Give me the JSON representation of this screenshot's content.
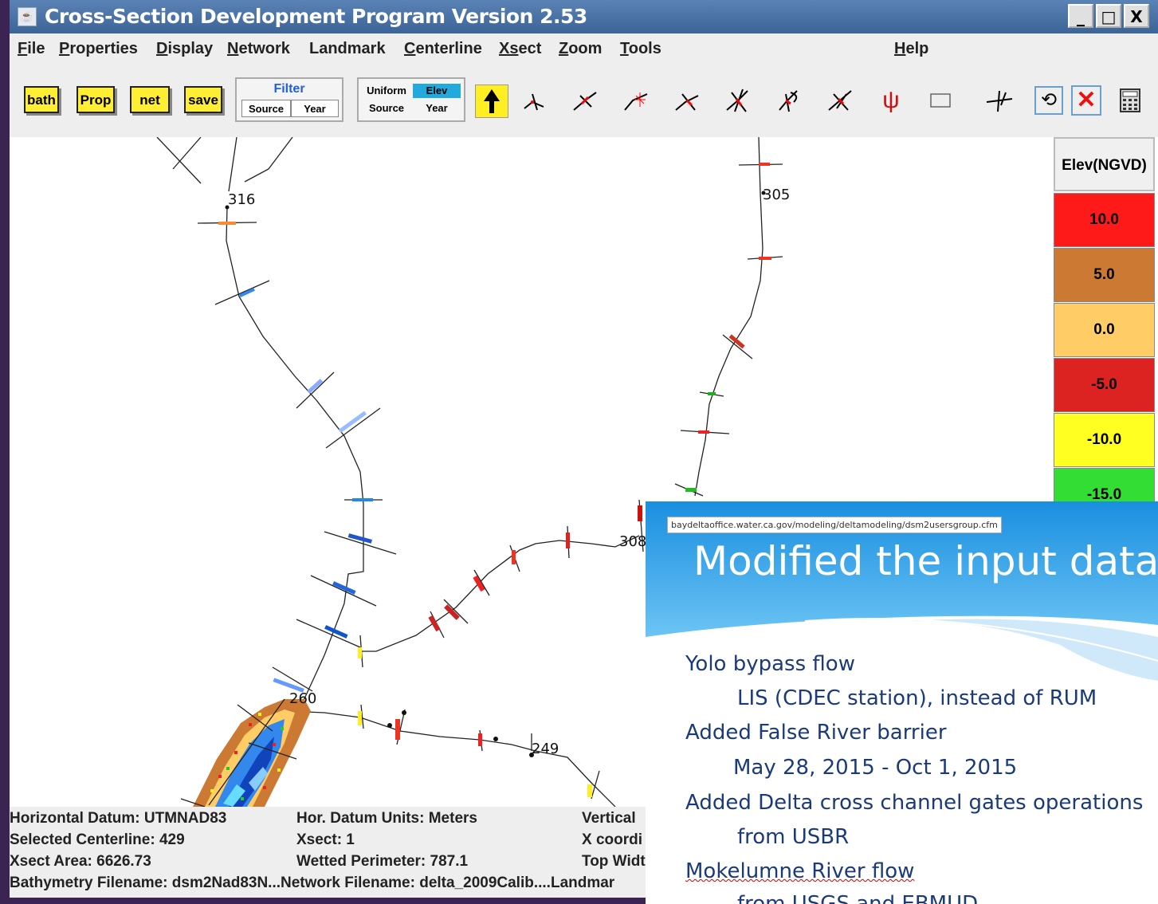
{
  "window": {
    "title": "Cross-Section Development Program Version 2.53",
    "minimize": "_",
    "maximize": "□",
    "close": "X"
  },
  "menu": {
    "items": [
      {
        "name": "menu-file",
        "label": "File",
        "underline": "F",
        "rest": "ile"
      },
      {
        "name": "menu-properties",
        "label": "Properties",
        "underline": "P",
        "rest": "roperties"
      },
      {
        "name": "menu-display",
        "label": "Display",
        "underline": "D",
        "rest": "isplay"
      },
      {
        "name": "menu-network",
        "label": "Network",
        "underline": "N",
        "rest": "etwork"
      },
      {
        "name": "menu-landmark",
        "label": "Landmark",
        "underline": "",
        "rest": "Landmark"
      },
      {
        "name": "menu-centerline",
        "label": "Centerline",
        "underline": "C",
        "rest": "enterline"
      },
      {
        "name": "menu-xsect",
        "label": "Xsect",
        "underline": "Xs",
        "rest": "ect"
      },
      {
        "name": "menu-zoom",
        "label": "Zoom",
        "underline": "Z",
        "rest": "oom"
      },
      {
        "name": "menu-tools",
        "label": "Tools",
        "underline": "T",
        "rest": "ools"
      },
      {
        "name": "menu-help",
        "label": "Help",
        "underline": "H",
        "rest": "elp"
      }
    ]
  },
  "toolbar": {
    "bath": "bath",
    "prop": "Prop",
    "net": "net",
    "save": "save",
    "filter": {
      "title": "Filter",
      "source": "Source",
      "year": "Year"
    },
    "color_mode": {
      "uniform": "Uniform",
      "elev": "Elev",
      "source": "Source",
      "year": "Year"
    },
    "icons": [
      "arrow-select-icon",
      "add-point-icon",
      "move-point-icon",
      "insert-point-icon",
      "add-xsect-icon",
      "move-xsect-icon",
      "rotate-xsect-icon",
      "delete-xsect-icon",
      "view-xsect-icon",
      "rectangle-select-icon",
      "restore-xsect-icon",
      "reverse-icon",
      "remove-icon",
      "calculator-icon"
    ]
  },
  "map": {
    "labels": [
      {
        "name": "node-label-316",
        "text": "316"
      },
      {
        "name": "node-label-305",
        "text": "305"
      },
      {
        "name": "node-label-308",
        "text": "308"
      },
      {
        "name": "node-label-260",
        "text": "260"
      },
      {
        "name": "node-label-249",
        "text": "249"
      }
    ]
  },
  "legend": {
    "header": "Elev(NGVD)",
    "cells": [
      {
        "label": "10.0",
        "color": "#ff1a1a"
      },
      {
        "label": "5.0",
        "color": "#cc7a33"
      },
      {
        "label": "0.0",
        "color": "#ffcc66"
      },
      {
        "label": "-5.0",
        "color": "#dd2222"
      },
      {
        "label": "-10.0",
        "color": "#ffff22"
      },
      {
        "label": "-15.0",
        "color": "#33dd33"
      }
    ]
  },
  "status": {
    "horizontal_datum": "Horizontal Datum: UTMNAD83",
    "hor_units": "Hor. Datum Units: Meters",
    "vertical": "Vertical",
    "selected_centerline": "Selected Centerline:  429",
    "xsect": "Xsect:  1",
    "x_coord": "X coordi",
    "xsect_area": "Xsect Area:  6626.73",
    "wetted_perimeter": "Wetted Perimeter:  787.1",
    "top_width": "Top Widt",
    "filenames": "Bathymetry Filename:  dsm2Nad83N...Network Filename:  delta_2009Calib....Landmar"
  },
  "slide": {
    "url": "baydeltaoffice.water.ca.gov/modeling/deltamodeling/dsm2usersgroup.cfm",
    "url_bold": "ca.gov",
    "heading": "Modified the input data s",
    "bullets": [
      {
        "text": "Yolo bypass flow",
        "indent": 0
      },
      {
        "text": "LIS (CDEC station), instead of RUM",
        "indent": 1
      },
      {
        "text": "Added False River barrier",
        "indent": 0
      },
      {
        "text": "May 28, 2015 - Oct 1, 2015",
        "indent": 1
      },
      {
        "text": "Added Delta cross channel gates operations",
        "indent": 0
      },
      {
        "text": "from USBR",
        "indent": 1
      },
      {
        "text": "Mokelumne River flow",
        "indent": 0
      },
      {
        "text": "from USGS and EBMUD",
        "indent": 1
      }
    ]
  }
}
